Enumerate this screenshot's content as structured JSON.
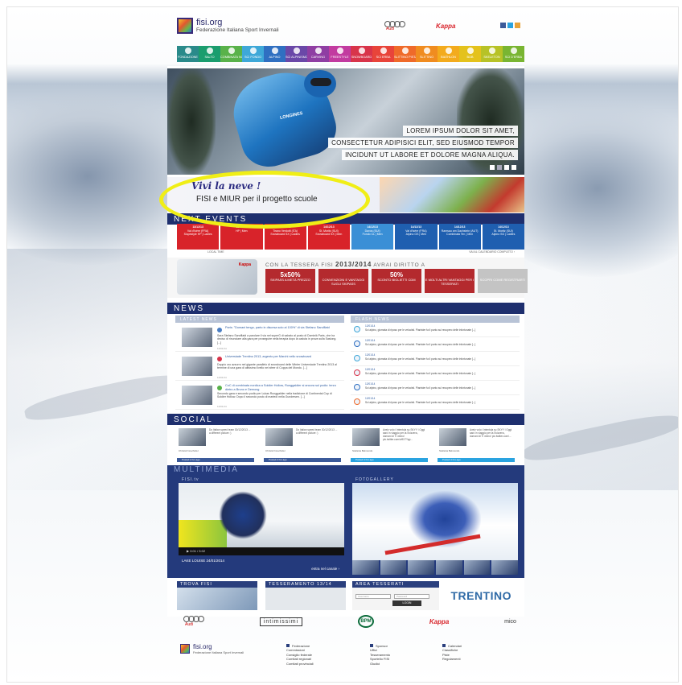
{
  "header": {
    "site_name": "fisi.org",
    "federation": "Federazione Italiana Sport Invernali",
    "sponsor_audi": "Audi",
    "sponsor_kappa": "Kappa"
  },
  "menu": [
    {
      "label": "FONDAZIONE",
      "color": "#2a8a8a"
    },
    {
      "label": "SALTO",
      "color": "#1a9d6e"
    },
    {
      "label": "COMBINATA NORDICA",
      "color": "#59b24a"
    },
    {
      "label": "SCI FONDO",
      "color": "#3ea8d8"
    },
    {
      "label": "ALPINO",
      "color": "#2f6fc1"
    },
    {
      "label": "SCI ALPINISMO",
      "color": "#6a48a8"
    },
    {
      "label": "CARVING",
      "color": "#8f3ea3"
    },
    {
      "label": "FREESTYLE",
      "color": "#c23ba0"
    },
    {
      "label": "SNOWBOARD",
      "color": "#d8344a"
    },
    {
      "label": "SCI ERBA",
      "color": "#e8443a"
    },
    {
      "label": "SLITTINO PISTA NATURALE",
      "color": "#ef6a2a"
    },
    {
      "label": "SLITTINO",
      "color": "#f08c20"
    },
    {
      "label": "BIATHLON",
      "color": "#f3ab1d"
    },
    {
      "label": "BOB",
      "color": "#e4c21c"
    },
    {
      "label": "SKELETON",
      "color": "#b7c227"
    },
    {
      "label": "SCI D'ERBA",
      "color": "#79b532"
    }
  ],
  "hero": {
    "caption_lines": [
      "LOREM IPSUM DOLOR SIT AMET,",
      "CONSECTETUR ADIPISICI ELIT, SED EIUSMOD TEMPOR",
      "INCIDUNT UT LABORE ET DOLORE MAGNA ALIQUA."
    ],
    "sponsor_on_suit": "LONGINES"
  },
  "scuola": {
    "title": "Vivi la neve !",
    "subtitle": "FISI e MIUR per il progetto scuole"
  },
  "events": {
    "heading": "NEXT EVENTS",
    "items": [
      {
        "date": "13/12/13",
        "place": "Val d'Isère (FRA)",
        "disc": "Slopestyle HP | Ladies",
        "color": "#d8232a"
      },
      {
        "date": "13/12/13",
        "place": "",
        "disc": "HP | Men",
        "color": "#d8232a"
      },
      {
        "date": "13/12/13",
        "place": "Tirano Verdotti (ITA)",
        "disc": "Snowboard SX | Ladies",
        "color": "#d8232a"
      },
      {
        "date": "14/12/13",
        "place": "St. Moritz (SUI)",
        "disc": "Snowboard SX | Men",
        "color": "#d8232a"
      },
      {
        "date": "14/12/13",
        "place": "Davos (SUI)",
        "disc": "Fondo CL | Men",
        "color": "#3a8fd6"
      },
      {
        "date": "14/12/13",
        "place": "Val d'Isère (FRA)",
        "disc": "Alpino GS | Men",
        "color": "#1f5fb0"
      },
      {
        "date": "14/12/13",
        "place": "Ramsau am Dachstein (AUT)",
        "disc": "Combinata Ter. | Men",
        "color": "#1f5fb0"
      },
      {
        "date": "14/12/13",
        "place": "St. Moritz (SUI)",
        "disc": "Alpino SG | Ladies",
        "color": "#1f5fb0"
      }
    ],
    "local_time": "LOCAL TIME",
    "calendar_link": "VAI AL CALENDARIO COMPLETO ›"
  },
  "tessera": {
    "prefix": "CON LA TESSERA FISI",
    "season": "2013/2014",
    "suffix": "AVRAI DIRITTO A",
    "card_brand": "Kappa",
    "boxes": [
      {
        "big": "5x50%",
        "small": "SKIPASS A METÀ PREZZO"
      },
      {
        "big": "",
        "small": "CONVENZIONI E VANTAGGI SUGLI SKIPASS"
      },
      {
        "big": "50%",
        "small": "SCONTO BIGLIETTI CDM"
      },
      {
        "big": "",
        "small": "E MOLTI ALTRI VANTAGGI PER I TESSERATI"
      },
      {
        "big": "",
        "small": "SCOPRI COME REGISTRARTI"
      }
    ]
  },
  "news": {
    "heading": "NEWS",
    "latest_label": "LATEST NEWS",
    "flash_label": "FLASH NEWS",
    "latest": [
      {
        "title": "Paris: \"Domani tengo, parto in discesa solo al 100%\" di via Stefano Sandflatd",
        "text": "Sara Stefano Sandflatd a parolare il via nel superG di sabato al posto di Dominik Paris, che ha deciso di rinunciare alla gara per proseguire nella terapia dopo la caduta in prova sulla Saslong. [...]",
        "date": "12/01/14",
        "color": "#4b7fc4"
      },
      {
        "title": "Universiade Trentino 2013, argento per Marchi nello snowboard",
        "text": "Doppio oro azzurro nel gigante parallelo di snowboard delle Winter Universiade Trentino 2013 al termine di una gara di altissimo livello nei sfeer di Coppa del Mondo. [...]",
        "date": "12/01/14",
        "color": "#d8344a"
      },
      {
        "title": "CoC di combinata nordica a Soldier Hollow, Runggaldier si ancora sul podio: terzo dietro a Bruno e Demong",
        "text": "Secondo gara e secondo podio per Lukas Runggaldier nella tradizione di Continental Cup di Soldier Hollow. Dopo il secondo posto di martedì nella Gundersen. [...]",
        "date": "12/01/14",
        "color": "#59b24a"
      }
    ],
    "flash": [
      {
        "date": "12/01/14",
        "text": "Sci alpino, giornata di riposo per le velocisti. Pianister fa il punto sul recupero delle infortunate [...]",
        "color": "#3ea8d8"
      },
      {
        "date": "12/01/14",
        "text": "Sci alpino, giornata di riposo per le velocisti. Pianister fa il punto sul recupero delle infortunate [...]",
        "color": "#2f6fc1"
      },
      {
        "date": "12/01/14",
        "text": "Sci alpino, giornata di riposo per le velocisti. Pianister fa il punto sul recupero delle infortunate [...]",
        "color": "#3ea8d8"
      },
      {
        "date": "12/01/14",
        "text": "Sci alpino, giornata di riposo per le velocisti. Pianister fa il punto sul recupero delle infortunate [...]",
        "color": "#d8344a"
      },
      {
        "date": "12/01/14",
        "text": "Sci alpino, giornata di riposo per le velocisti. Pianister fa il punto sul recupero delle infortunate [...]",
        "color": "#2f6fc1"
      },
      {
        "date": "12/01/14",
        "text": "Sci alpino, giornata di riposo per le velocisti. Pianister fa il punto sul recupero delle infortunate [...]",
        "color": "#ef6a2a"
      }
    ]
  },
  "social": {
    "heading": "SOCIAL",
    "posts": [
      {
        "text": "Do Italian speed team 30/12/2013 ... a different picture :)",
        "user": "Christof Innerhofer",
        "bar": "Posted 2 hrs ago",
        "network": "facebook",
        "bar_color": "#3b5a9a"
      },
      {
        "text": "Do Italian speed team 30/12/2013 ... a different picture :)",
        "user": "Christof Innerhofer",
        "bar": "Posted 2 hrs ago",
        "network": "facebook",
        "bar_color": "#3b5a9a"
      },
      {
        "text": "Aveiz volo i Intentola su SKYY I Oggi sarò in viaggio per la Svizzera , domani di Ti vedro! pic.twitter.com/w9X7Yqp...",
        "user": "Stefania Belmondo",
        "bar": "Posted 4 hrs ago",
        "network": "twitter",
        "bar_color": "#2aa3e0"
      },
      {
        "text": "Aveiz volo i Intentola su SKYY I Oggi sarò in viaggio per la Svizzera , domani di Ti vedro! pic.twitter.com/...",
        "user": "Stefania Belmondo",
        "bar": "Posted 4 hrs ago",
        "network": "twitter",
        "bar_color": "#2aa3e0"
      }
    ]
  },
  "multimedia": {
    "heading": "MULTIMEDIA",
    "tv_label": "FISI.tv",
    "gallery_label": "FOTOGALLERY",
    "video_time": "0:01 / 3:02",
    "video_caption": "LAKE LOUISE 24/01/2014",
    "video_link": "entra nel canale ›"
  },
  "bottom": {
    "trova_label": "TROVA FISI",
    "tesseramento_label": "TESSERAMENTO 13/14",
    "area_label": "AREA TESSERATI",
    "user_placeholder": "Username",
    "pass_placeholder": "Password",
    "login_label": "LOGIN",
    "trentino": "TRENTINO"
  },
  "sponsors": [
    "Audi",
    "intimissimi",
    "BPM",
    "Kappa",
    "mico"
  ],
  "footer": {
    "site": "fisi.org",
    "fed": "Federazione Italiana Sport Invernali",
    "col1": [
      "Federazione",
      "Commissioni",
      "Consiglio federale",
      "Comitati regionali",
      "Comitati provinciali"
    ],
    "col2": [
      "Sponsor",
      "Uffici",
      "Tesseramento",
      "Sportello FISI",
      "Giudici"
    ],
    "col3": [
      "Calendari",
      "Classifiche",
      "Piste",
      "Regolamenti"
    ]
  }
}
